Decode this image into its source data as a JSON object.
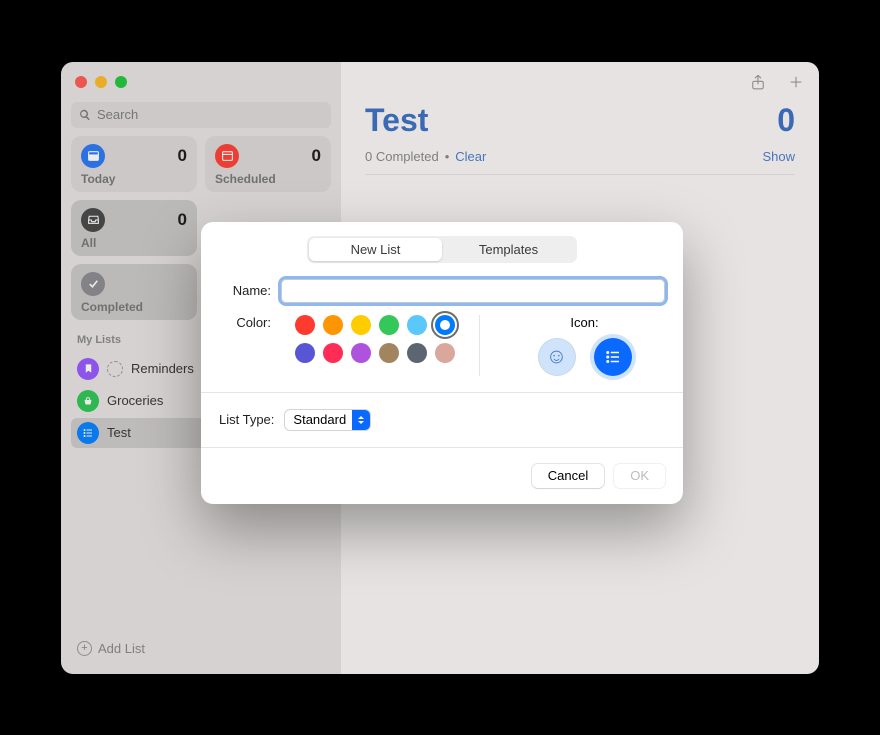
{
  "search": {
    "placeholder": "Search"
  },
  "cards": {
    "today": {
      "label": "Today",
      "count": "0"
    },
    "scheduled": {
      "label": "Scheduled",
      "count": "0"
    },
    "all": {
      "label": "All",
      "count": "0"
    },
    "completed": {
      "label": "Completed"
    }
  },
  "sidebar": {
    "section": "My Lists",
    "items": [
      {
        "label": "Reminders"
      },
      {
        "label": "Groceries"
      },
      {
        "label": "Test"
      }
    ],
    "addList": "Add List"
  },
  "main": {
    "title": "Test",
    "count": "0",
    "completed": "0 Completed",
    "clear": "Clear",
    "show": "Show"
  },
  "modal": {
    "tabs": {
      "new": "New List",
      "templates": "Templates"
    },
    "nameLabel": "Name:",
    "nameValue": "",
    "colorLabel": "Color:",
    "iconLabel": "Icon:",
    "listTypeLabel": "List Type:",
    "listTypeValue": "Standard",
    "cancel": "Cancel",
    "ok": "OK",
    "colors": {
      "row1": [
        "#ff3b30",
        "#ff9500",
        "#ffcc00",
        "#34c759",
        "#5ac8fa",
        "#007aff"
      ],
      "row2": [
        "#5856d6",
        "#ff2d55",
        "#af52de",
        "#a2845e",
        "#5b6670",
        "#d9a79b"
      ]
    },
    "selectedColorIndex": 5
  }
}
